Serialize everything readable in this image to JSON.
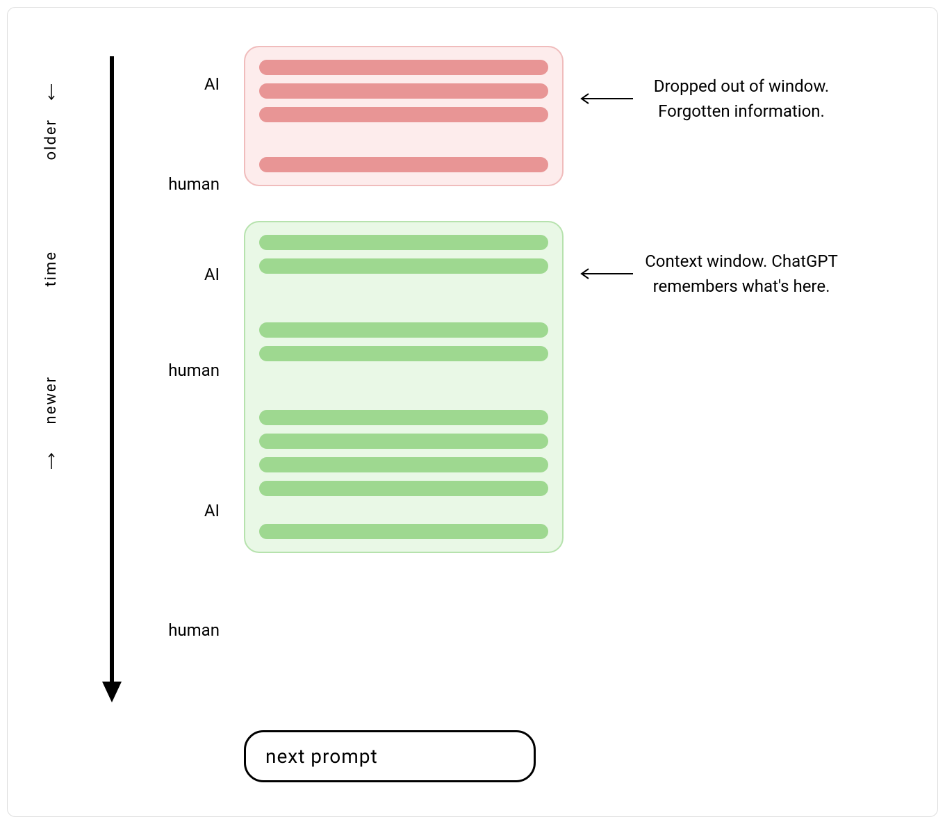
{
  "axis": {
    "older": "older",
    "time_label": "time",
    "newer": "newer"
  },
  "roles": {
    "ai": "AI",
    "human": "human"
  },
  "annotations": {
    "dropped": "Dropped out of window. Forgotten information.",
    "context": "Context window. ChatGPT remembers what's here."
  },
  "prompt_label": "next prompt",
  "colors": {
    "red_bg": "#fdecec",
    "red_border": "#f0bcbc",
    "red_bar": "#e89595",
    "green_bg": "#e9f8e6",
    "green_border": "#b6e2ad",
    "green_bar": "#9ed890"
  },
  "diagram": {
    "dropped_window": [
      {
        "speaker": "AI",
        "lines": 3
      },
      {
        "speaker": "human",
        "lines": 1
      }
    ],
    "context_window": [
      {
        "speaker": "AI",
        "lines": 2
      },
      {
        "speaker": "human",
        "lines": 2
      },
      {
        "speaker": "AI",
        "lines": 4
      },
      {
        "speaker": "human",
        "lines": 1
      }
    ]
  }
}
